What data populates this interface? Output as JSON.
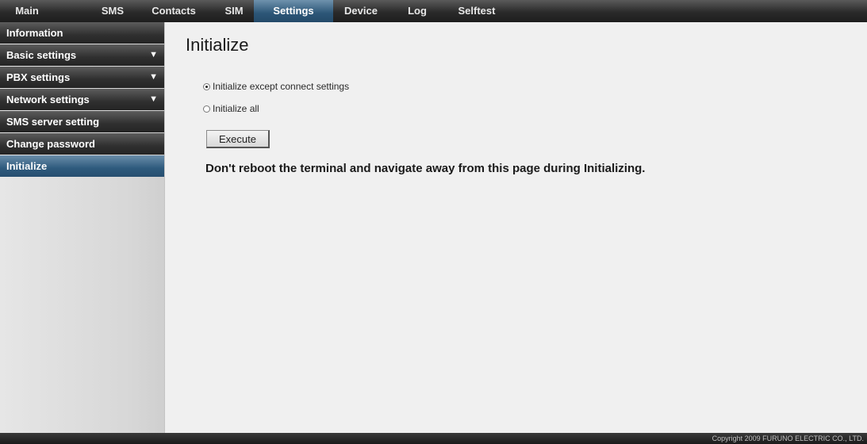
{
  "topnav": {
    "tabs": [
      {
        "label": "Main"
      },
      {
        "label": "SMS"
      },
      {
        "label": "Contacts"
      },
      {
        "label": "SIM"
      },
      {
        "label": "Settings",
        "active": true
      },
      {
        "label": "Device"
      },
      {
        "label": "Log"
      },
      {
        "label": "Selftest"
      }
    ]
  },
  "sidebar": {
    "items": [
      {
        "label": "Information"
      },
      {
        "label": "Basic settings",
        "has_submenu": true
      },
      {
        "label": "PBX settings",
        "has_submenu": true
      },
      {
        "label": "Network settings",
        "has_submenu": true
      },
      {
        "label": "SMS server setting"
      },
      {
        "label": "Change password"
      },
      {
        "label": "Initialize",
        "active": true
      }
    ],
    "submenu_arrow": "▼"
  },
  "main": {
    "title": "Initialize",
    "options": [
      {
        "label": "Initialize except connect settings",
        "checked": true
      },
      {
        "label": "Initialize all",
        "checked": false
      }
    ],
    "execute_label": "Execute",
    "warning": "Don't reboot the terminal and navigate away from this page during Initializing."
  },
  "footer": {
    "copyright": "Copyright 2009 FURUNO ELECTRIC CO., LTD."
  },
  "colors": {
    "active_tab": "#2c5677",
    "nav_bg": "#2a2a2a",
    "content_bg": "#f0f0f0"
  }
}
